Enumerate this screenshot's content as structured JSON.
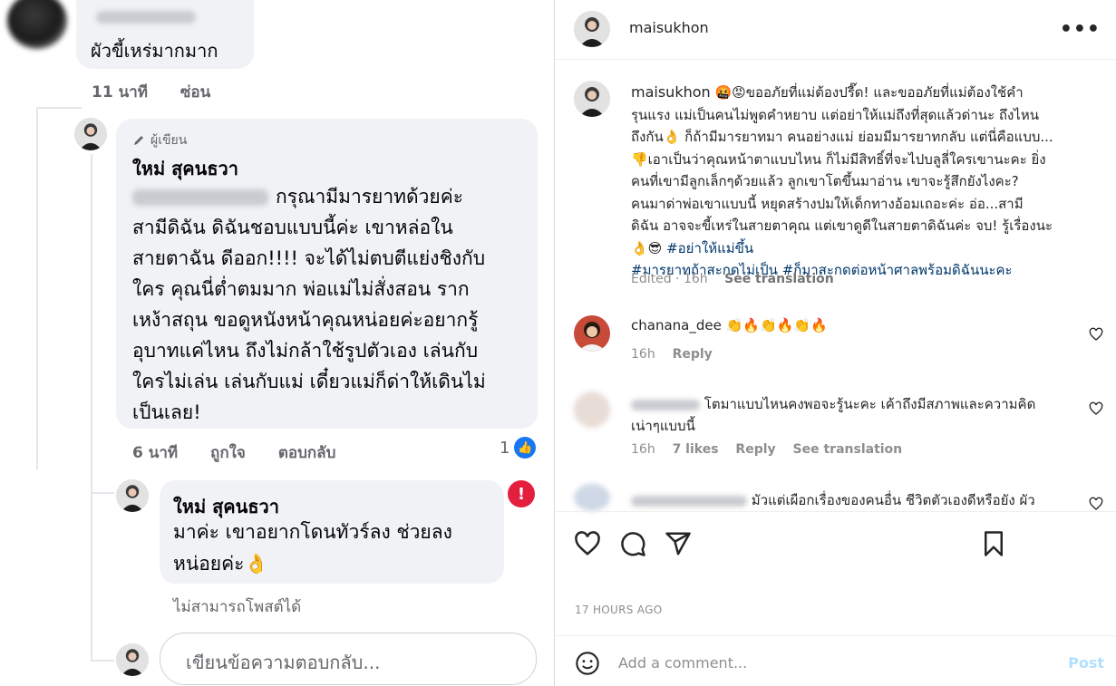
{
  "facebook": {
    "top_comment": {
      "text": "ผัวขี้เหร่มากมาก",
      "time": "11 นาที",
      "hide_label": "ซ่อน"
    },
    "author_reply": {
      "author_tag": "ผู้เขียน",
      "name": "ใหม่ สุคนธวา",
      "lines": [
        "กรุณามีมารยาทด้วยค่ะ",
        "สามีดิฉัน ดิฉันชอบแบบนี้ค่ะ เขาหล่อใน",
        "สายตาฉัน ดีออก!!!! จะได้ไม่ตบตีแย่งชิงกับ",
        "ใคร คุณนี่ต่ำตมมาก พ่อแม่ไม่สั่งสอน ราก",
        "เหง้าสถุน ขอดูหนังหน้าคุณหน่อยค่ะอยากรู้",
        "อุบาทแค่ไหน ถึงไม่กล้าใช้รูปตัวเอง เล่นกับ",
        "ใครไม่เล่น เล่นกับแม่ เดี๋ยวแม่ก็ด่าให้เดินไม่",
        "เป็นเลย!"
      ],
      "time": "6 นาที",
      "like_label": "ถูกใจ",
      "reply_label": "ตอบกลับ",
      "like_count": "1"
    },
    "second_reply": {
      "name": "ใหม่ สุคนธวา",
      "lines": [
        "มาค่ะ เขาอยากโดนทัวร์ลง ช่วยลง",
        "หน่อยค่ะ👌"
      ],
      "error_text": "ไม่สามารถโพสต์ได้"
    },
    "reply_placeholder": "เขียนข้อความตอบกลับ..."
  },
  "instagram": {
    "username": "maisukhon",
    "caption_lines": [
      "🤬😡ขออภัยที่แม่ต้องปรี๊ด! และขออภัยที่แม่ต้องใช้คำ",
      "รุนแรง แม่เป็นคนไม่พูดคำหยาบ แต่อย่าให้แม่ถึงที่สุดแล้วด่านะ ถึงไหน",
      "ถึงกัน👌 ก็ถ้ามีมารยาทมา คนอย่างแม่ ย่อมมีมารยาทกลับ แต่นี่คือแบบ...",
      "👎เอาเป็นว่าคุณหน้าตาแบบไหน ก็ไม่มีสิทธิ์ที่จะไปบลูลี่ใครเขานะคะ ยิ่ง",
      "คนที่เขามีลูกเล็กๆด้วยแล้ว ลูกเขาโตขึ้นมาอ่าน เขาจะรู้สึกยังไงคะ?",
      "คนมาด่าพ่อเขาแบบนี้ หยุดสร้างปมให้เด็กทางอ้อมเถอะค่ะ อ่อ...สามี",
      "ดิฉัน อาจจะขี้เหร่ในสายตาคุณ แต่เขาดูดีในสายตาดิฉันค่ะ จบ! รู้เรื่องนะ"
    ],
    "caption_emoji_end": "👌😎",
    "hashtags": [
      "#อย่าให้แม่ขึ้น",
      "#มารยาทถ้าสะกดไม่เป็น",
      "#ก็มาสะกดต่อหน้าศาลพร้อมดิฉันนะคะ"
    ],
    "caption_meta": {
      "edited": "Edited · 16h",
      "translate": "See translation"
    },
    "comments": [
      {
        "username": "chanana_dee",
        "text": "👏🔥👏🔥👏🔥",
        "time": "16h",
        "reply": "Reply"
      },
      {
        "text_line1": "โตมาแบบไหนคงพอจะรู้นะคะ เค้าถึงมีสภาพและความคิด",
        "text_line2": "เน่าๆแบบนี้",
        "time": "16h",
        "likes": "7 likes",
        "reply": "Reply",
        "translate": "See translation"
      },
      {
        "text": "มัวแต่เผือกเรื่องของคนอื่น ชีวิตตัวเองดีหรือยัง ผัว"
      }
    ],
    "time_ago": "17 HOURS AGO",
    "add_comment_placeholder": "Add a comment...",
    "post_label": "Post",
    "icons": [
      "heart-icon",
      "comment-icon",
      "share-icon",
      "bookmark-icon",
      "emoji-icon",
      "more-icon"
    ]
  }
}
